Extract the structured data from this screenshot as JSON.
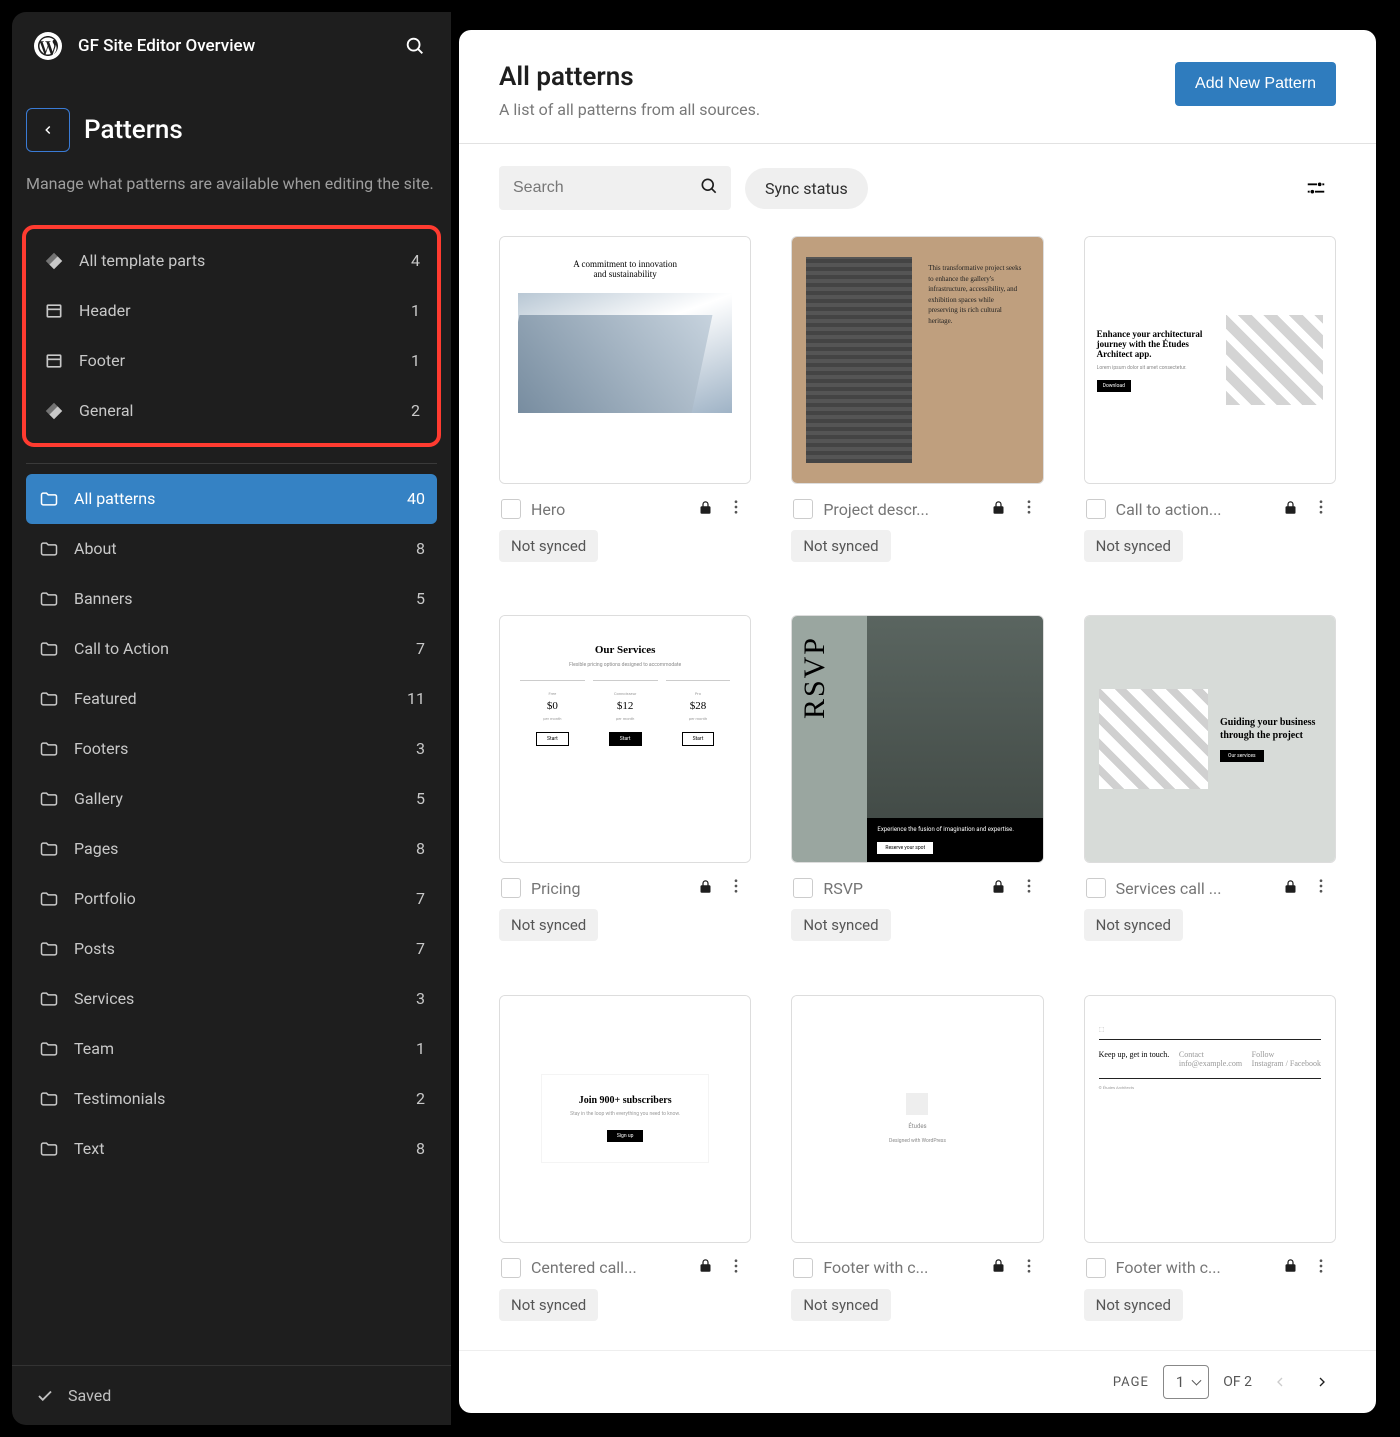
{
  "site_title": "GF Site Editor Overview",
  "sidebar": {
    "title": "Patterns",
    "description": "Manage what patterns are available when editing the site.",
    "template_parts": [
      {
        "label": "All template parts",
        "count": "4",
        "icon": "diamond"
      },
      {
        "label": "Header",
        "count": "1",
        "icon": "layout"
      },
      {
        "label": "Footer",
        "count": "1",
        "icon": "layout"
      },
      {
        "label": "General",
        "count": "2",
        "icon": "diamond"
      }
    ],
    "categories": [
      {
        "label": "All patterns",
        "count": "40",
        "active": true
      },
      {
        "label": "About",
        "count": "8"
      },
      {
        "label": "Banners",
        "count": "5"
      },
      {
        "label": "Call to Action",
        "count": "7"
      },
      {
        "label": "Featured",
        "count": "11"
      },
      {
        "label": "Footers",
        "count": "3"
      },
      {
        "label": "Gallery",
        "count": "5"
      },
      {
        "label": "Pages",
        "count": "8"
      },
      {
        "label": "Portfolio",
        "count": "7"
      },
      {
        "label": "Posts",
        "count": "7"
      },
      {
        "label": "Services",
        "count": "3"
      },
      {
        "label": "Team",
        "count": "1"
      },
      {
        "label": "Testimonials",
        "count": "2"
      },
      {
        "label": "Text",
        "count": "8"
      }
    ],
    "saved_label": "Saved"
  },
  "main": {
    "title": "All patterns",
    "subtitle": "A list of all patterns from all sources.",
    "add_button": "Add New Pattern",
    "search_placeholder": "Search",
    "sync_chip": "Sync status",
    "cards": [
      {
        "title": "Hero",
        "badge": "Not synced"
      },
      {
        "title": "Project descr...",
        "badge": "Not synced"
      },
      {
        "title": "Call to action...",
        "badge": "Not synced"
      },
      {
        "title": "Pricing",
        "badge": "Not synced"
      },
      {
        "title": "RSVP",
        "badge": "Not synced"
      },
      {
        "title": "Services call ...",
        "badge": "Not synced"
      },
      {
        "title": "Centered call...",
        "badge": "Not synced"
      },
      {
        "title": "Footer with c...",
        "badge": "Not synced"
      },
      {
        "title": "Footer with c...",
        "badge": "Not synced"
      }
    ],
    "pager": {
      "page_label": "PAGE",
      "current": "1",
      "of_label": "OF 2"
    }
  }
}
